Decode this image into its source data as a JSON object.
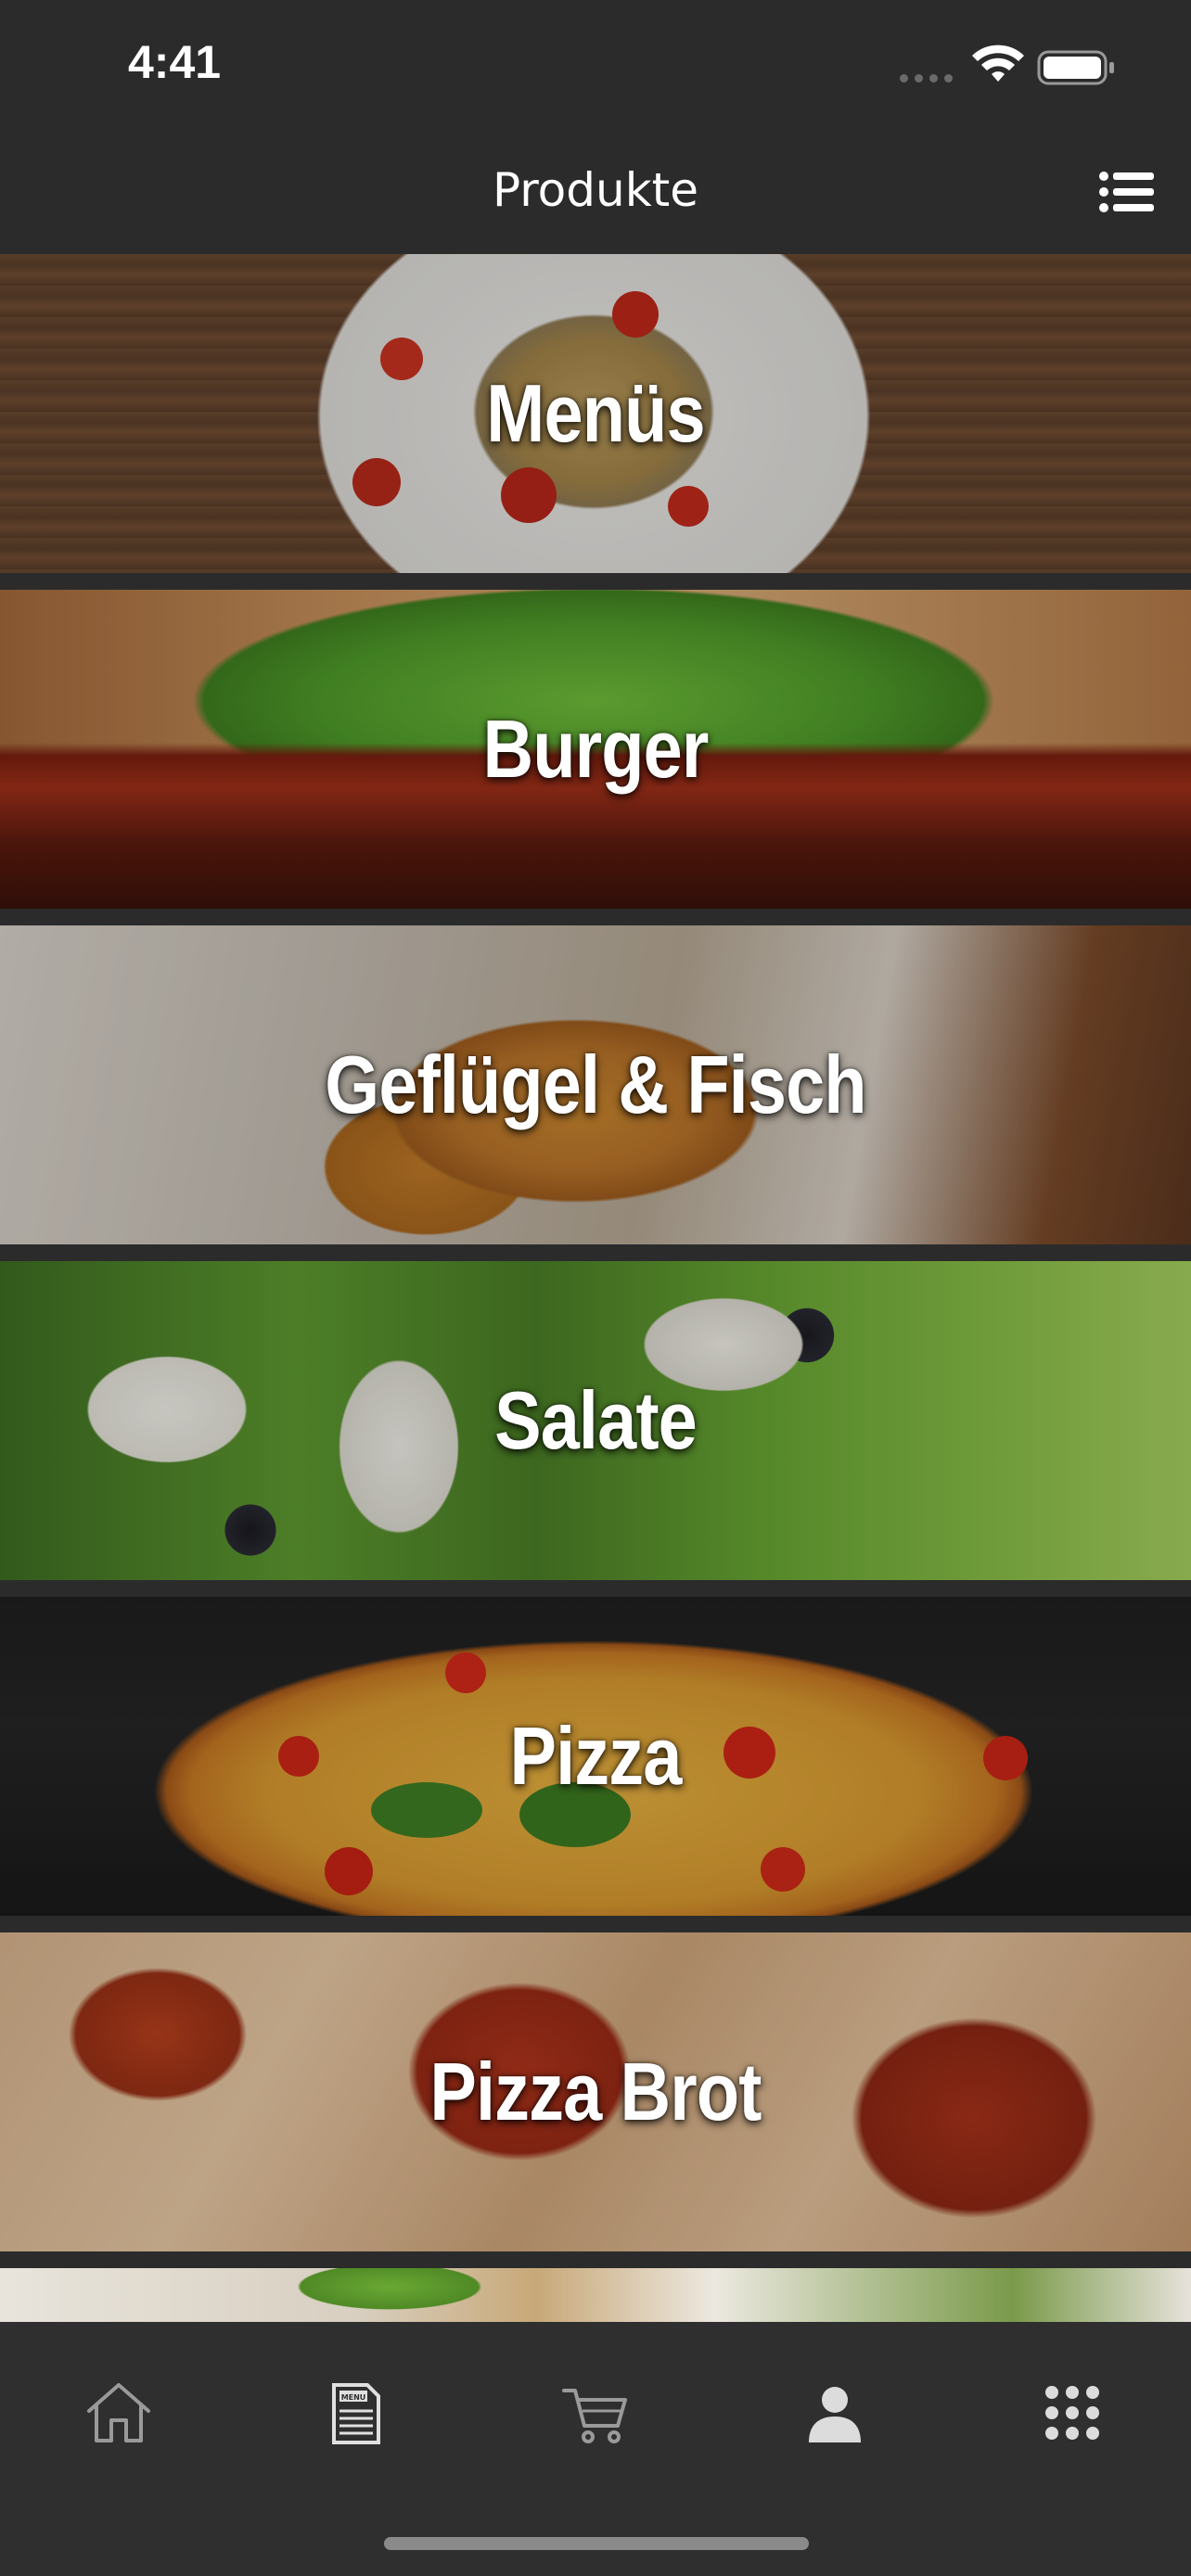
{
  "status_bar": {
    "time": "4:41",
    "icons": [
      "signal-dots-icon",
      "wifi-icon",
      "battery-icon"
    ]
  },
  "nav_bar": {
    "title": "Produkte",
    "right_icon": "list-icon"
  },
  "categories": [
    {
      "label": "Menüs"
    },
    {
      "label": "Burger"
    },
    {
      "label": "Geflügel & Fisch"
    },
    {
      "label": "Salate"
    },
    {
      "label": "Pizza"
    },
    {
      "label": "Pizza Brot"
    },
    {
      "label": ""
    }
  ],
  "tab_bar": {
    "items": [
      {
        "icon": "home-icon",
        "active": false
      },
      {
        "icon": "menu-card-icon",
        "active": true
      },
      {
        "icon": "cart-icon",
        "active": false
      },
      {
        "icon": "user-icon",
        "active": false
      },
      {
        "icon": "grid-icon",
        "active": false
      }
    ]
  },
  "colors": {
    "background": "#2b2b2b",
    "tab_bar": "#2f2f2f",
    "icon_inactive": "#9a9a9a",
    "icon_active": "#e0e0e0",
    "text": "#ffffff"
  }
}
